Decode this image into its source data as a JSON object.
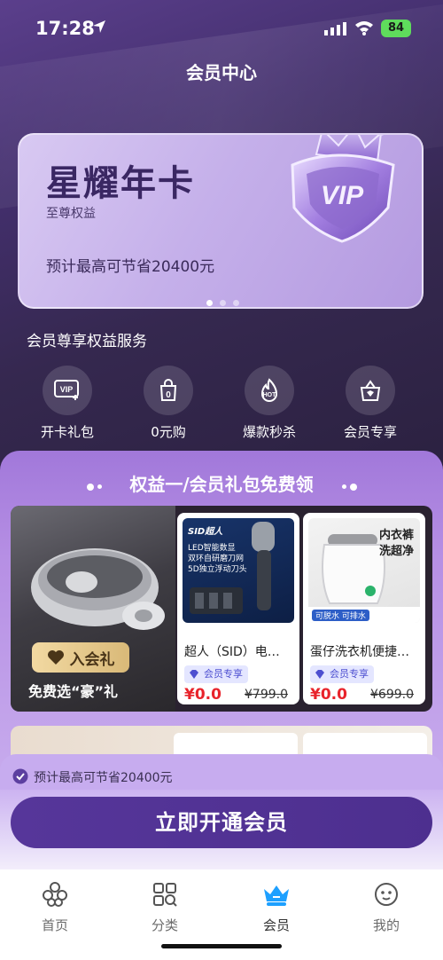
{
  "status_bar": {
    "time": "17:28",
    "battery": "84"
  },
  "page_title": "会员中心",
  "card": {
    "title": "星耀年卡",
    "subtitle": "至尊权益",
    "savings": "预计最高可节省20400元",
    "badge_text": "VIP"
  },
  "services": {
    "heading": "会员尊享权益服务",
    "items": [
      {
        "label": "开卡礼包",
        "icon": "vip-gift-icon"
      },
      {
        "label": "0元购",
        "icon": "zero-purchase-icon"
      },
      {
        "label": "爆款秒杀",
        "icon": "hot-flash-sale-icon"
      },
      {
        "label": "会员专享",
        "icon": "member-exclusive-icon"
      }
    ]
  },
  "gift_section": {
    "title": "权益一/会员礼包免费领",
    "promo": {
      "badge": "入会礼",
      "text": "免费选“豪”礼"
    },
    "products": [
      {
        "name": "超人（SID）电…",
        "tag": "会员专享",
        "price": "¥0.0",
        "original_price": "¥799.0",
        "image_brand": "SID超人",
        "image_lines": [
          "LED智能数显",
          "双环自研磨刀网",
          "5D独立浮动刀头"
        ]
      },
      {
        "name": "蛋仔洗衣机便捷…",
        "tag": "会员专享",
        "price": "¥0.0",
        "original_price": "¥699.0",
        "image_lines": [
          "内衣裤",
          "洗超净"
        ],
        "image_caption": "可脱水  可排水"
      }
    ]
  },
  "bottom": {
    "savings_note": "预计最高可节省20400元",
    "cta": "立即开通会员"
  },
  "tabbar": {
    "tabs": [
      {
        "label": "首页",
        "icon": "home-icon"
      },
      {
        "label": "分类",
        "icon": "category-icon"
      },
      {
        "label": "会员",
        "icon": "member-crown-icon",
        "active": true
      },
      {
        "label": "我的",
        "icon": "profile-icon"
      }
    ]
  },
  "colors": {
    "accent": "#4d2f8f",
    "price": "#e8232b",
    "active_tab": "#1ea0ff"
  }
}
